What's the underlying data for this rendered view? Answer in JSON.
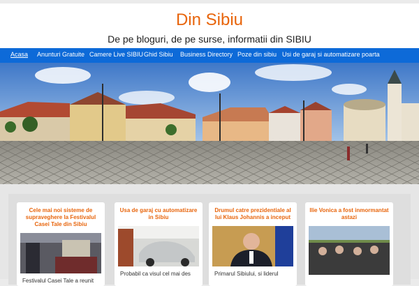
{
  "site": {
    "title": "Din Sibiu",
    "tagline": "De pe bloguri, de pe surse, informatii din SIBIU"
  },
  "nav": {
    "items": [
      {
        "label": "Acasa",
        "active": true
      },
      {
        "label": "Anunturi Gratuite"
      },
      {
        "label": "Camere Live SIBIU"
      },
      {
        "label": "Ghid Sibiu"
      },
      {
        "label": "Business Directory"
      },
      {
        "label": "Poze din sibiu"
      },
      {
        "label": "Usi de garaj si automatizare poarta"
      }
    ]
  },
  "colors": {
    "accent": "#e8650c",
    "nav_bg": "#0d6ad8"
  },
  "posts": [
    {
      "title": "Cele mai noi sisteme de supraveghere la Festivalul Casei Tale din Sibiu",
      "excerpt": "Festivalul Casei Tale a reunit"
    },
    {
      "title": "Usa de garaj cu automatizare in Sibiu",
      "excerpt": "Probabil ca visul cel mai des"
    },
    {
      "title": "Drumul catre prezidentiale al lui Klaus Johannis a inceput",
      "excerpt": "Primarul Sibiului, si liderul"
    },
    {
      "title": "Ilie Vonica a fost inmormantat astazi",
      "excerpt": ""
    }
  ]
}
